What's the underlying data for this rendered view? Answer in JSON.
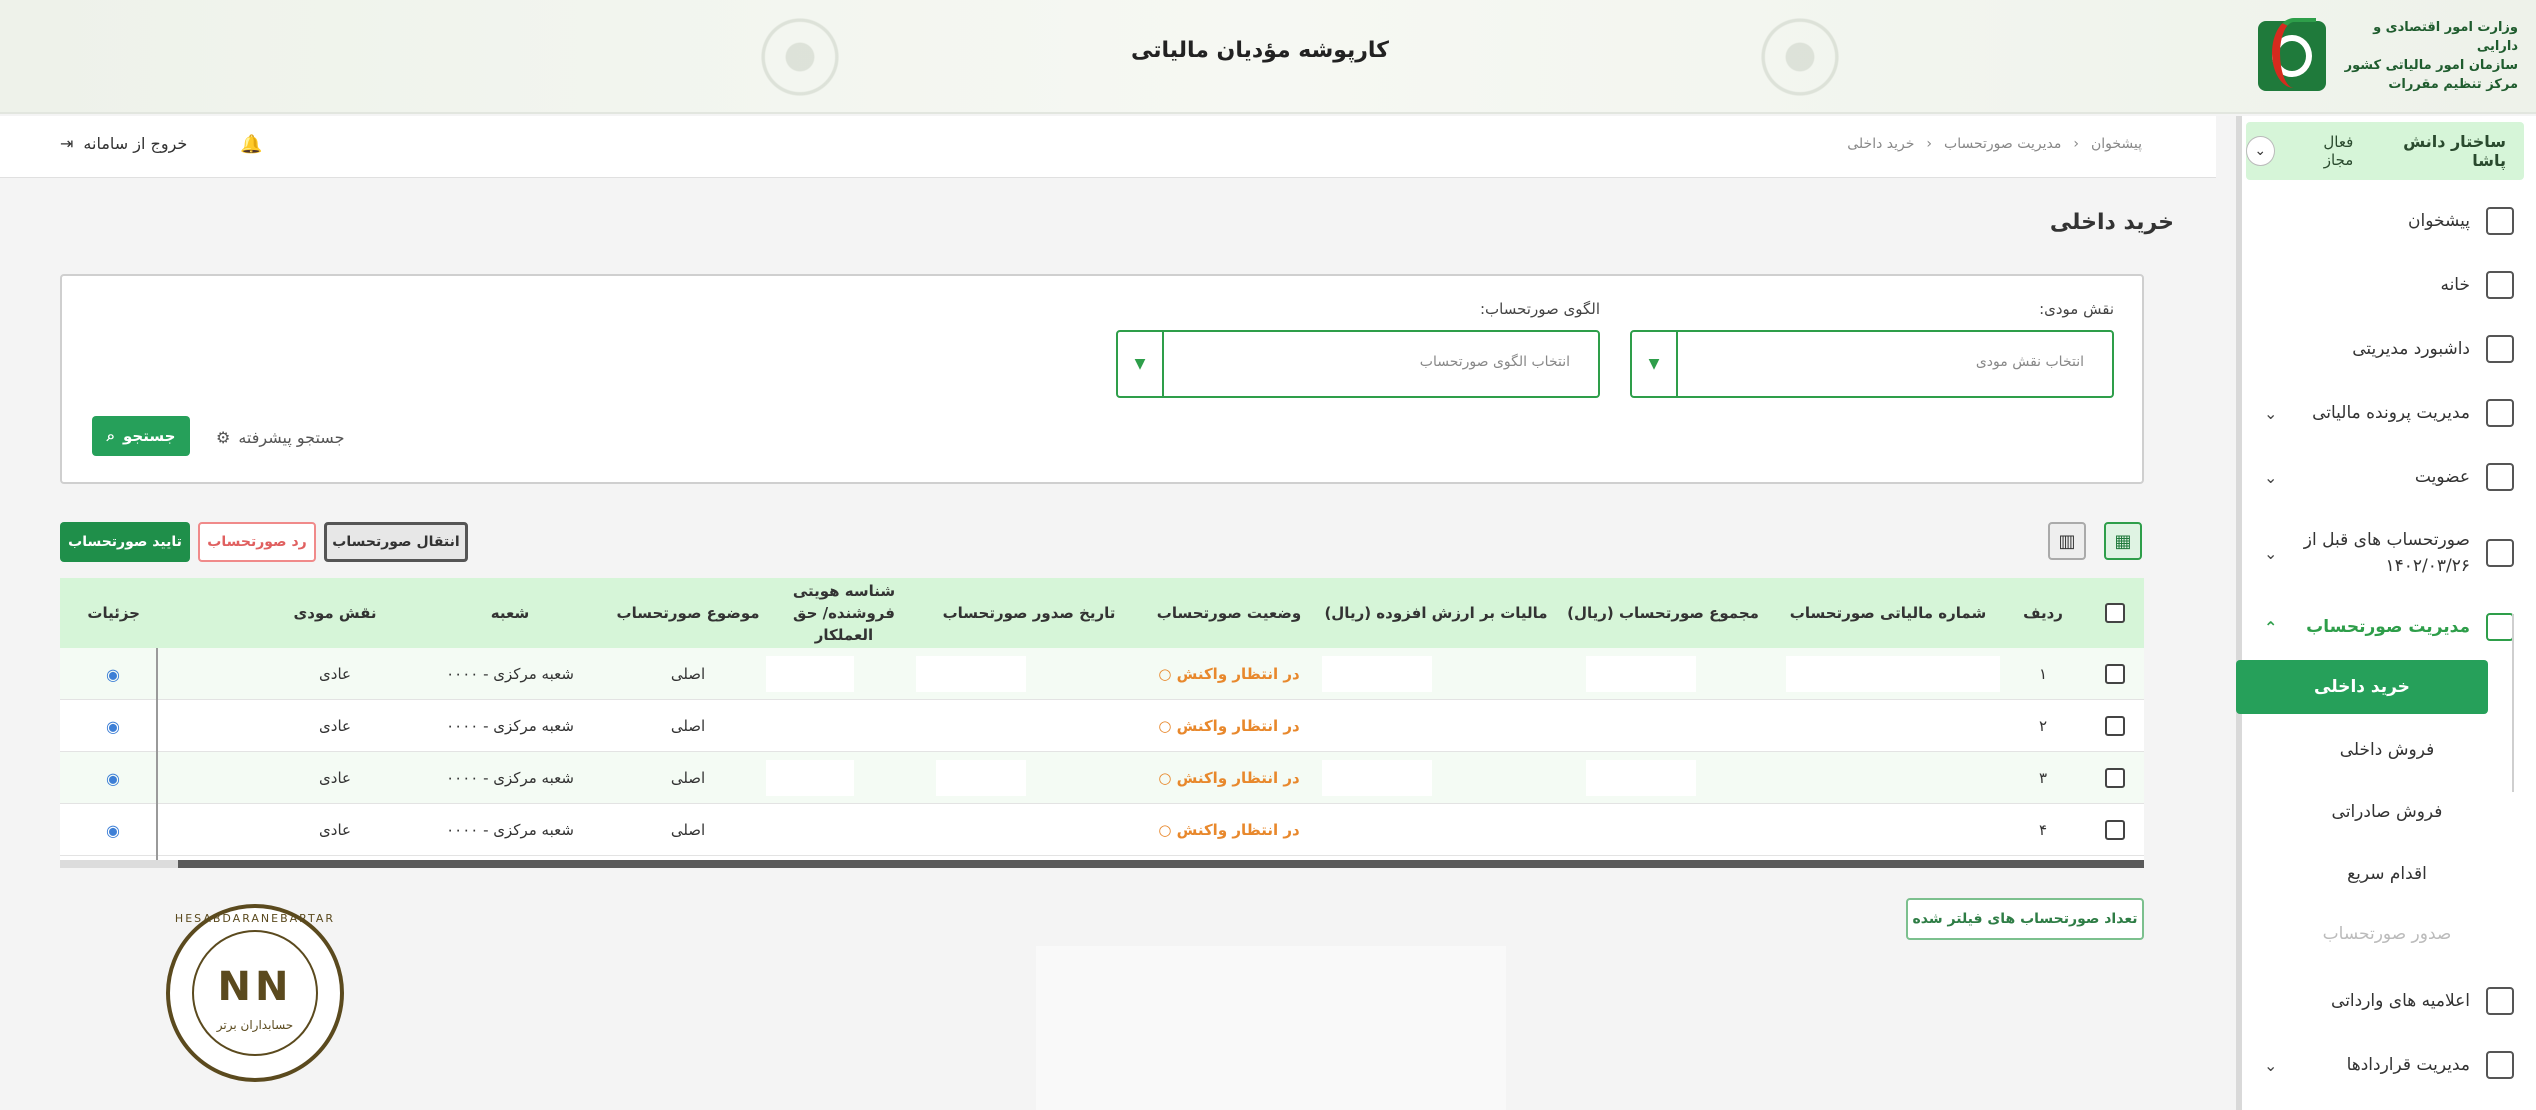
{
  "header": {
    "title": "کارپوشه مؤدیان مالیاتی",
    "logo_lines": [
      "وزارت امور اقتصادی و دارایی",
      "سازمان امور مالیاتی کشور",
      "مرکز تنظیم مقررات"
    ]
  },
  "navbar": {
    "breadcrumb": [
      "پیشخوان",
      "مدیریت صورتحساب",
      "خرید داخلی"
    ],
    "exit_label": "خروج از سامانه"
  },
  "sidebar": {
    "user_name": "ساختار دانش پاشا",
    "user_status": "فعال مجاز",
    "items": [
      {
        "label": "پیشخوان",
        "icon": "dashboard-icon"
      },
      {
        "label": "خانه",
        "icon": "home-icon"
      },
      {
        "label": "داشبورد مدیریتی",
        "icon": "grid-icon"
      },
      {
        "label": "مدیریت پرونده مالیاتی",
        "icon": "file-icon"
      },
      {
        "label": "عضویت",
        "icon": "user-icon"
      },
      {
        "label": "صورتحساب های قبل از ۱۴۰۲/۰۳/۲۶",
        "icon": "receipt-icon"
      },
      {
        "label": "مدیریت صورتحساب",
        "icon": "receipt-icon"
      },
      {
        "label": "اعلامیه های وارداتی",
        "icon": "receipt-icon"
      },
      {
        "label": "مدیریت قراردادها",
        "icon": "contract-icon"
      }
    ],
    "sub_items": [
      "خرید داخلی",
      "فروش داخلی",
      "فروش صادراتی",
      "اقدام سریع",
      "صدور صورتحساب"
    ]
  },
  "page": {
    "title": "خرید داخلی",
    "filters": {
      "role_label": "نقش مودی:",
      "role_placeholder": "انتخاب نقش مودی",
      "pattern_label": "الگوی صورتحساب:",
      "pattern_placeholder": "انتخاب الگوی صورتحساب",
      "advanced_search": "جستجو پیشرفته",
      "search_button": "جستجو"
    },
    "actions": {
      "approve": "تایید صورتحساب",
      "reject": "رد صورتحساب",
      "transfer": "انتقال صورتحساب"
    },
    "table": {
      "columns": [
        "ردیف",
        "شماره مالیاتی صورتحساب",
        "مجموع صورتحساب (ریال)",
        "مالیات بر ارزش افزوده (ریال)",
        "وضعیت صورتحساب",
        "تاریخ صدور صورتحساب",
        "شناسه هویتی فروشنده/ حق العملکار",
        "موضوع صورتحساب",
        "شعبه",
        "نقش مودی",
        "جزئیات"
      ],
      "rows": [
        {
          "index": "۱",
          "status": "در انتظار واکنش",
          "subject": "اصلی",
          "branch": "شعبه مرکزی - ۰۰۰۰",
          "role": "عادی"
        },
        {
          "index": "۲",
          "status": "در انتظار واکنش",
          "subject": "اصلی",
          "branch": "شعبه مرکزی - ۰۰۰۰",
          "role": "عادی"
        },
        {
          "index": "۳",
          "status": "در انتظار واکنش",
          "subject": "اصلی",
          "branch": "شعبه مرکزی - ۰۰۰۰",
          "role": "عادی"
        },
        {
          "index": "۴",
          "status": "در انتظار واکنش",
          "subject": "اصلی",
          "branch": "شعبه مرکزی - ۰۰۰۰",
          "role": "عادی"
        }
      ]
    },
    "filtered_count_button": "تعداد صورتحساب های فیلتر شده"
  },
  "stamp": {
    "latin": "HESABDARANEBARTAR",
    "farsi": "حسابداران برتر"
  },
  "colors": {
    "primary": "#26a05a",
    "header_row": "#d6f5d8",
    "status_pending": "#e8882c",
    "reject": "#e06060"
  }
}
